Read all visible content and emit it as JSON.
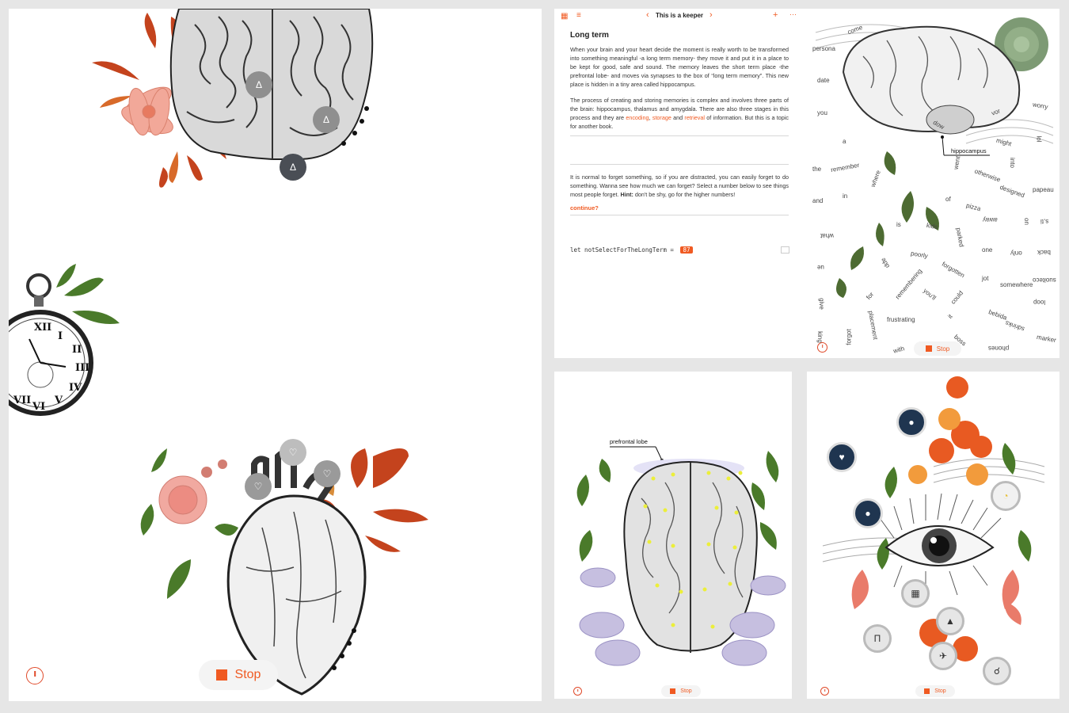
{
  "main": {
    "stop_label": "Stop"
  },
  "top": {
    "title": "This is a keeper",
    "heading": "Long term",
    "para1_a": "When your brain and your heart decide the moment is really worth to be transformed into something meaningful -a long term memory- they move it and put it in a place to be kept for good, safe and sound. The memory leaves the short term place -the prefrontal lobe- and moves via synapses to the box of “long term memory”. This new place is hidden in a tiny area called hippocampus.",
    "para2_a": "The process of creating and storing memories is complex and involves three parts of the brain: hippocampus, thalamus and amygdala. There are also three stages in this process and they are ",
    "para2_encoding": "encoding",
    "para2_sep": ", ",
    "para2_storage": "storage",
    "para2_and": " and ",
    "para2_retrieval": "retrieval",
    "para2_b": " of information. But this is a topic for another book.",
    "para3_a": "It is normal to forget something, so if you are distracted, you can easily forget to do something. Wanna see how much we can forget? Select a number below to see things most people forget. ",
    "para3_hint": "Hint:",
    "para3_b": " don't be shy, go for the higher numbers!",
    "continue": "continue?",
    "code_text": "let notSelectForTheLongTerm = ",
    "code_value": "87",
    "hippocampus_label": "hippocampus",
    "stop_label": "Stop",
    "words": [
      "come",
      "persona",
      "the",
      "date",
      "you",
      "a",
      "the",
      "remember",
      "and",
      "in",
      "what",
      "ue",
      "give",
      "king",
      "forgot",
      "with",
      "hippocampus",
      "might",
      "worry",
      "vor",
      "lol",
      "into",
      "otherwise",
      "designed",
      "papeau",
      "pizza",
      "away",
      "on",
      "s,ti",
      "kids",
      "parked",
      "one",
      "only",
      "back",
      "poorly",
      "forgotten",
      "jot",
      "somewhere",
      "suoiteco",
      "remembering",
      "you'll",
      "could",
      "loop",
      "for",
      "frustrating",
      "it",
      "bebida",
      "sdrinks",
      "marker",
      "placement",
      "boss",
      "phones",
      "went",
      "it",
      "of",
      "is",
      "app",
      "dow",
      "eves",
      "where"
    ]
  },
  "bottom_left": {
    "label": "prefrontal lobe",
    "stop_label": "Stop"
  },
  "bottom_right": {
    "stop_label": "Stop"
  },
  "colors": {
    "accent": "#f05a22",
    "page": "#ffffff",
    "background": "#e6e6e6",
    "button_grey": "#9a9a9a",
    "button_dark": "#4a4e55"
  }
}
